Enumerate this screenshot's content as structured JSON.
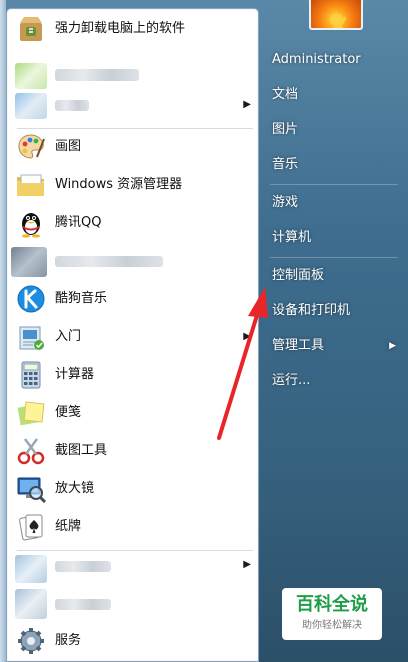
{
  "left_menu": {
    "items": [
      {
        "label": "强力卸载电脑上的软件",
        "icon": "uninstall-box-icon",
        "arrow": ""
      },
      {
        "label": "",
        "icon": "blurred-app-icon",
        "arrow": ""
      },
      {
        "label": "",
        "icon": "blurred-app-icon",
        "arrow": "▶"
      },
      {
        "label": "画图",
        "icon": "paint-palette-icon",
        "arrow": ""
      },
      {
        "label": "Windows 资源管理器",
        "icon": "folder-explorer-icon",
        "arrow": ""
      },
      {
        "label": "腾讯QQ",
        "icon": "qq-penguin-icon",
        "arrow": ""
      },
      {
        "label": "",
        "icon": "blurred-app-icon",
        "arrow": ""
      },
      {
        "label": "酷狗音乐",
        "icon": "kugou-music-icon",
        "arrow": ""
      },
      {
        "label": "入门",
        "icon": "getting-started-icon",
        "arrow": "▶"
      },
      {
        "label": "计算器",
        "icon": "calculator-icon",
        "arrow": ""
      },
      {
        "label": "便笺",
        "icon": "sticky-notes-icon",
        "arrow": ""
      },
      {
        "label": "截图工具",
        "icon": "snipping-tool-icon",
        "arrow": ""
      },
      {
        "label": "放大镜",
        "icon": "magnifier-icon",
        "arrow": ""
      },
      {
        "label": "纸牌",
        "icon": "solitaire-cards-icon",
        "arrow": ""
      },
      {
        "label": "",
        "icon": "blurred-app-icon",
        "arrow": "▶"
      },
      {
        "label": "",
        "icon": "blurred-app-icon",
        "arrow": ""
      },
      {
        "label": "服务",
        "icon": "services-gear-icon",
        "arrow": ""
      }
    ]
  },
  "right_menu": {
    "items": [
      {
        "label": "Administrator",
        "arrow": ""
      },
      {
        "label": "文档",
        "arrow": ""
      },
      {
        "label": "图片",
        "arrow": ""
      },
      {
        "label": "音乐",
        "arrow": ""
      },
      {
        "label": "游戏",
        "arrow": ""
      },
      {
        "label": "计算机",
        "arrow": ""
      },
      {
        "label": "控制面板",
        "arrow": ""
      },
      {
        "label": "设备和打印机",
        "arrow": ""
      },
      {
        "label": "管理工具",
        "arrow": "▶"
      },
      {
        "label": "运行...",
        "arrow": ""
      }
    ]
  },
  "user_picture": {
    "icon": "flower-user-picture-icon"
  },
  "annotation": {
    "color": "#e8262a",
    "icon": "red-arrow-icon"
  },
  "watermark": {
    "title": "百科全说",
    "subtitle": "助你轻松解决",
    "color": "#1f9e4a"
  },
  "colors": {
    "taskbar_glass": "#3e6d8f",
    "menu_bg": "#ffffff"
  }
}
